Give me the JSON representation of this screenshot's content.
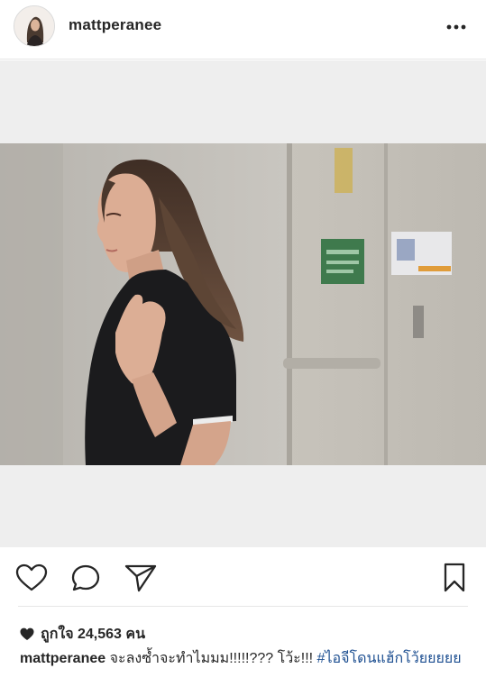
{
  "header": {
    "username": "mattperanee",
    "avatar_icon": "avatar-image",
    "more_icon": "more-dots-icon"
  },
  "actions": {
    "like_icon": "heart-outline-icon",
    "comment_icon": "comment-bubble-icon",
    "share_icon": "paper-plane-icon",
    "save_icon": "bookmark-icon"
  },
  "likes": {
    "label": "ถูกใจ 24,563 คน",
    "icon": "heart-filled-icon"
  },
  "caption": {
    "username": "mattperanee",
    "text": "จะลงซ้ำจะทำไมมม!!!!!??? โว้ะ!!! ",
    "hashtag": "#ไอจีโดนแฮ้กโว้ยยยยย"
  },
  "colors": {
    "text": "#262626",
    "hashtag": "#1d4f91",
    "divider": "#e6e6e6",
    "media_bg": "#eeeeee"
  }
}
